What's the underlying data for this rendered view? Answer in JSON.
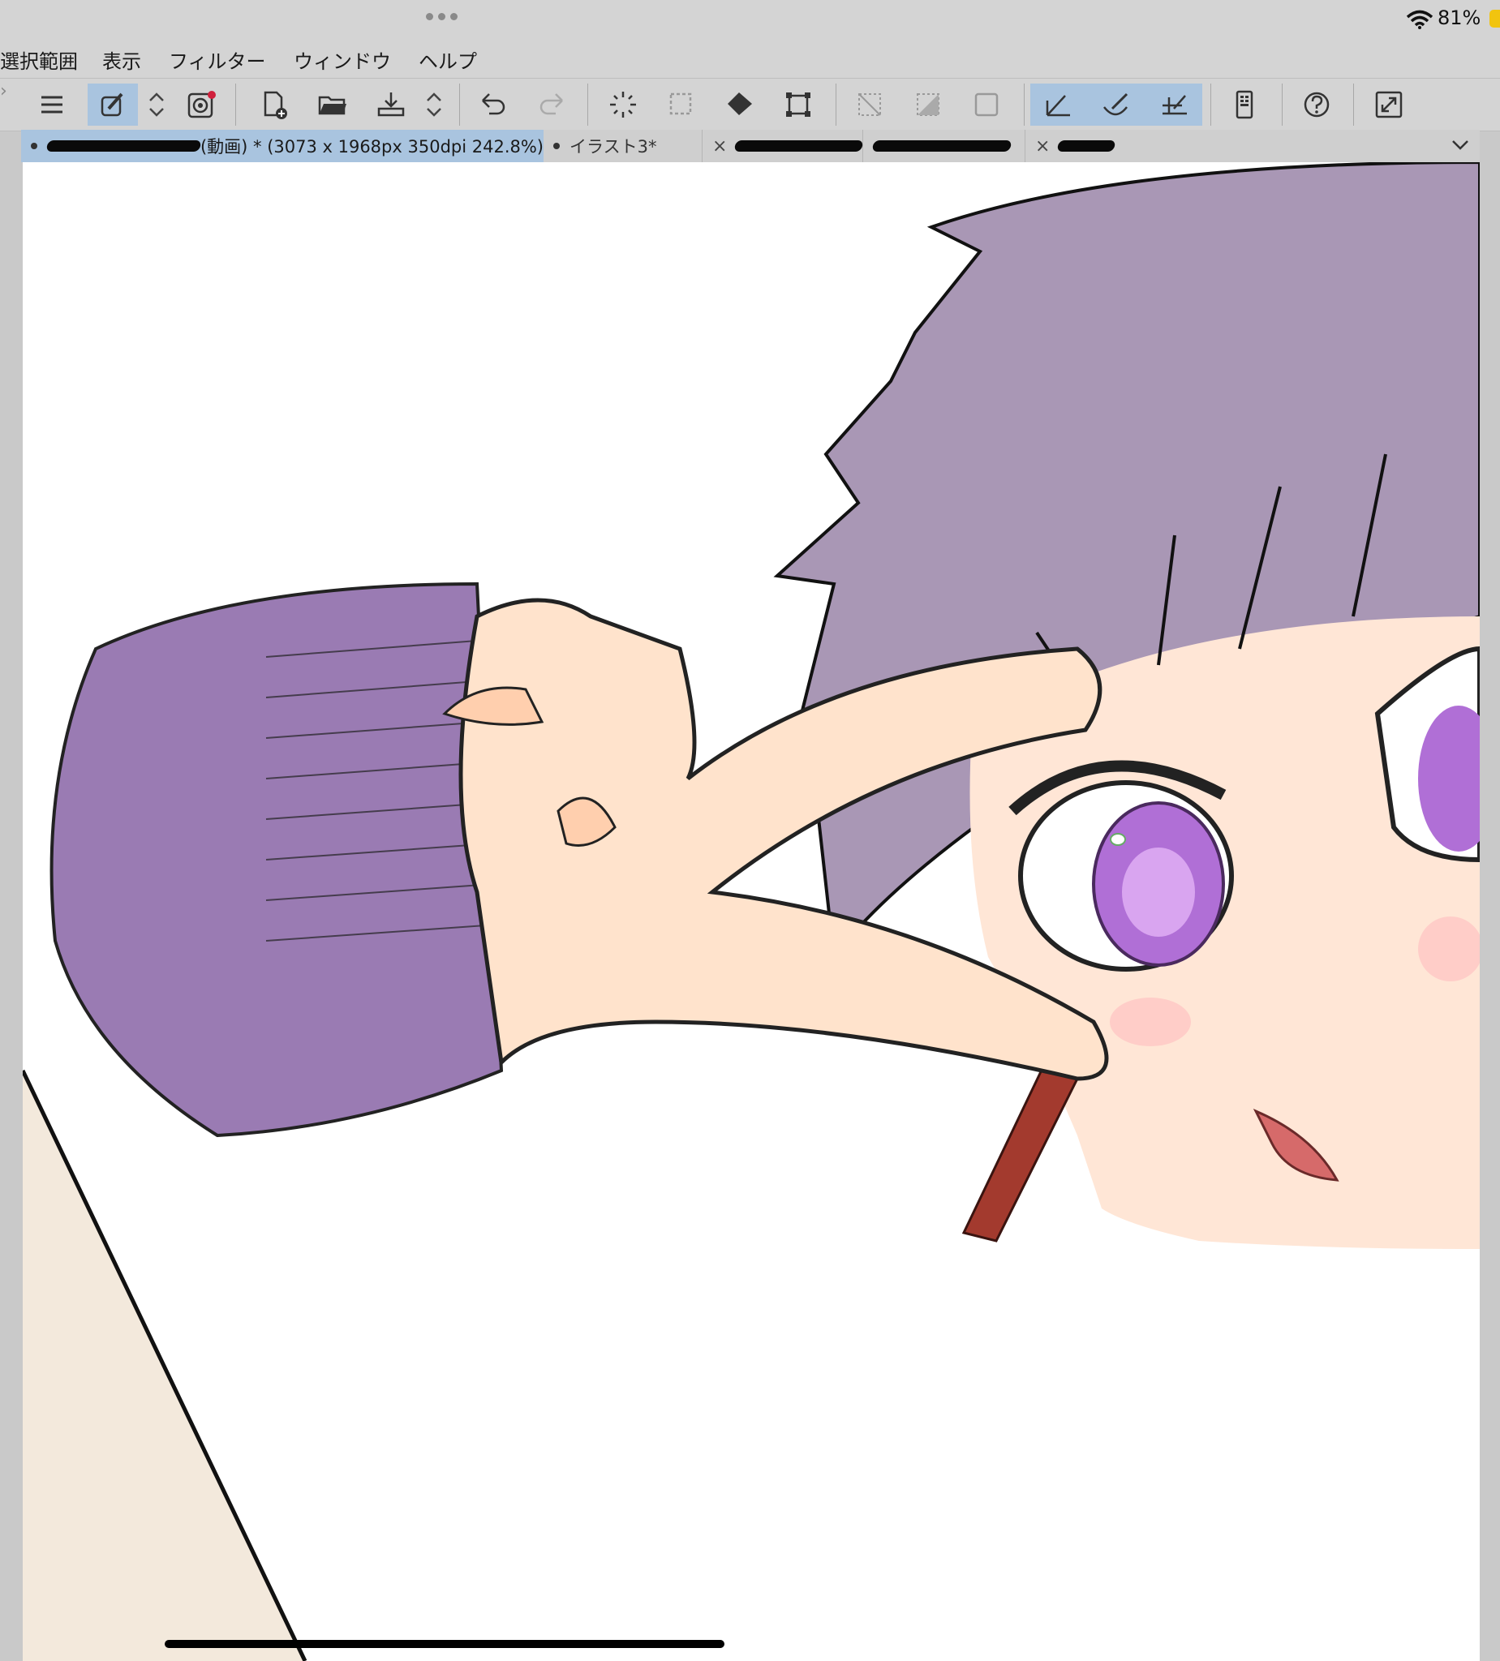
{
  "status_bar": {
    "battery_percent": "81%",
    "wifi_icon": "wifi-icon",
    "battery_icon": "battery-icon",
    "battery_color": "#f1c40f"
  },
  "menu": {
    "items": [
      "選択範囲",
      "表示",
      "フィルター",
      "ウィンドウ",
      "ヘルプ"
    ]
  },
  "toolbar": {
    "icons": [
      "menu-icon",
      "eyedropper-pen-icon",
      "updown-icon",
      "companion-icon",
      "new-file-icon",
      "open-folder-icon",
      "save-icon",
      "updown-icon",
      "undo-icon",
      "redo-icon",
      "select-all-icon",
      "deselect-icon",
      "fill-icon",
      "transform-icon",
      "clear-selection-icon",
      "invert-selection-icon",
      "selection-border-icon",
      "ruler-icon",
      "curve-ruler-icon",
      "perspective-ruler-icon",
      "device-settings-icon",
      "help-icon",
      "fullscreen-icon"
    ],
    "active_color": "#a9c4df"
  },
  "tabs": [
    {
      "label": "(動画) * (3073 x 1968px 350dpi 242.8%)",
      "active": true
    },
    {
      "label": "イラスト3*",
      "active": false
    },
    {
      "label": "",
      "active": false
    },
    {
      "label": "",
      "active": false
    },
    {
      "label": "",
      "active": false
    }
  ],
  "canvas": {
    "background": "#ffffff",
    "artwork": "character-illustration",
    "hair_color": "#a997b5",
    "sleeve_color": "#9a7bb3",
    "skin_color": "#ffe6d6",
    "eye_color": "#b06fd6"
  }
}
